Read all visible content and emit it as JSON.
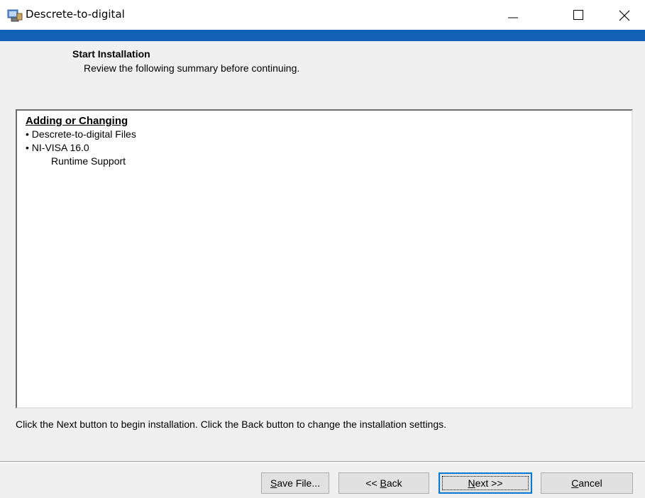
{
  "window": {
    "title": "Descrete-to-digital",
    "icon": "installer-icon",
    "controls": [
      "minimize-icon",
      "maximize-icon",
      "close-icon"
    ]
  },
  "header": {
    "title": "Start Installation",
    "subtitle": "Review the following summary before continuing."
  },
  "summary": {
    "heading": "Adding or Changing",
    "items": [
      {
        "text": "• Descrete-to-digital Files"
      },
      {
        "text": "• NI-VISA 16.0"
      },
      {
        "text": "Runtime Support"
      }
    ]
  },
  "instruction": "Click the Next button to begin installation.  Click the Back button to change the installation settings.",
  "buttons": {
    "save": {
      "mnemonic": "S",
      "rest": "ave File..."
    },
    "back": {
      "prefix": "<< ",
      "mnemonic": "B",
      "rest": "ack"
    },
    "next": {
      "mnemonic": "N",
      "rest": "ext >>"
    },
    "cancel": {
      "mnemonic": "C",
      "rest": "ancel"
    }
  },
  "colors": {
    "accent_bar": "#1161b7",
    "background": "#f0f0f0",
    "default_button_border": "#0078d7"
  }
}
